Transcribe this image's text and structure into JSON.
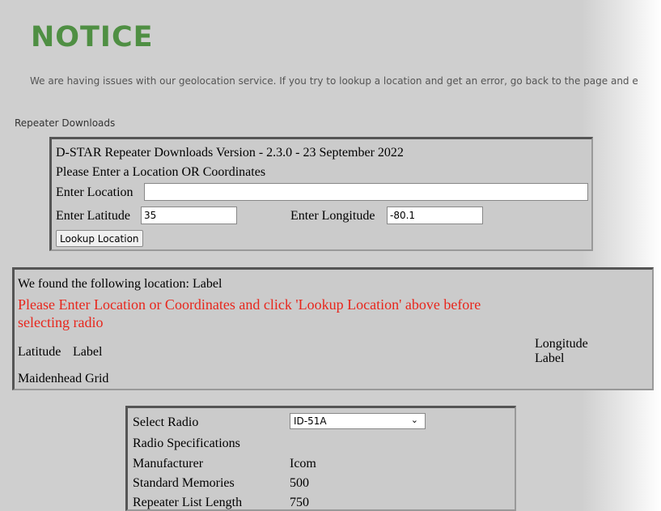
{
  "notice": {
    "title": "NOTICE",
    "message": "We are  having issues with our geolocation service. If you try to lookup a location and get an error, go back to the page and e"
  },
  "section_link": "Repeater Downloads",
  "lookup": {
    "version": "D-STAR Repeater Downloads Version - 2.3.0 - 23 September 2022",
    "instruction": "Please Enter a Location OR Coordinates",
    "location_label": "Enter Location",
    "location_value": "",
    "latitude_label": "Enter Latitude",
    "latitude_value": "35",
    "longitude_label": "Enter Longitude",
    "longitude_value": "-80.1",
    "button_label": "Lookup Location"
  },
  "result": {
    "found": "We found the following location: Label",
    "warning": "Please Enter Location or Coordinates and click 'Lookup Location' above before selecting radio",
    "latitude_label": "Latitude",
    "latitude_value": "Label",
    "longitude_label": "Longitude",
    "longitude_value": "Label",
    "grid_label": "Maidenhead Grid"
  },
  "radio": {
    "select_label": "Select Radio",
    "selected": "ID-51A",
    "specs_heading": "Radio Specifications",
    "manufacturer_label": "Manufacturer",
    "manufacturer_value": "Icom",
    "memories_label": "Standard Memories",
    "memories_value": "500",
    "repeater_label": "Repeater List Length",
    "repeater_value": "750"
  }
}
